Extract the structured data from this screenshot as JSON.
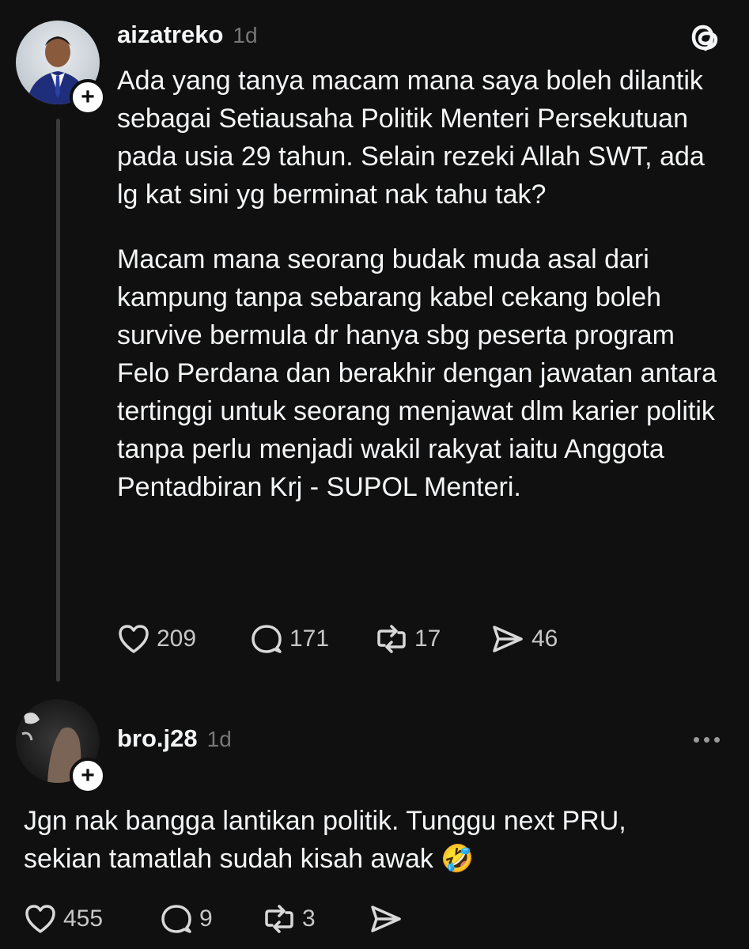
{
  "posts": [
    {
      "username": "aizatreko",
      "time": "1d",
      "paragraphs": [
        "Ada yang tanya macam mana saya boleh dilantik sebagai Setiausaha Politik Menteri Persekutuan pada usia 29 tahun. Selain rezeki Allah SWT, ada lg kat sini yg berminat nak tahu tak?",
        "Macam mana seorang budak muda asal dari kampung tanpa sebarang kabel cekang boleh survive bermula dr hanya sbg peserta program Felo Perdana dan berakhir dengan jawatan antara tertinggi untuk seorang menjawat dlm karier politik tanpa perlu menjadi wakil rakyat iaitu Anggota Pentadbiran Krj - SUPOL Menteri."
      ],
      "likes": "209",
      "replies": "171",
      "reposts": "17",
      "shares": "46",
      "follow_symbol": "+"
    },
    {
      "username": "bro.j28",
      "time": "1d",
      "text_line1": "Jgn nak bangga lantikan politik. Tunggu next PRU,",
      "text_line2": "sekian tamatlah sudah kisah awak 🤣",
      "likes": "455",
      "replies": "9",
      "reposts": "3",
      "follow_symbol": "+"
    }
  ],
  "icons": {
    "brand": "threads-logo-icon",
    "like": "heart-icon",
    "reply": "comment-icon",
    "repost": "repost-icon",
    "share": "share-icon",
    "more": "more-icon"
  },
  "colors": {
    "background": "#101010",
    "text": "#f3f5f7",
    "muted": "#777777",
    "thread_line": "#3a3a3a"
  }
}
